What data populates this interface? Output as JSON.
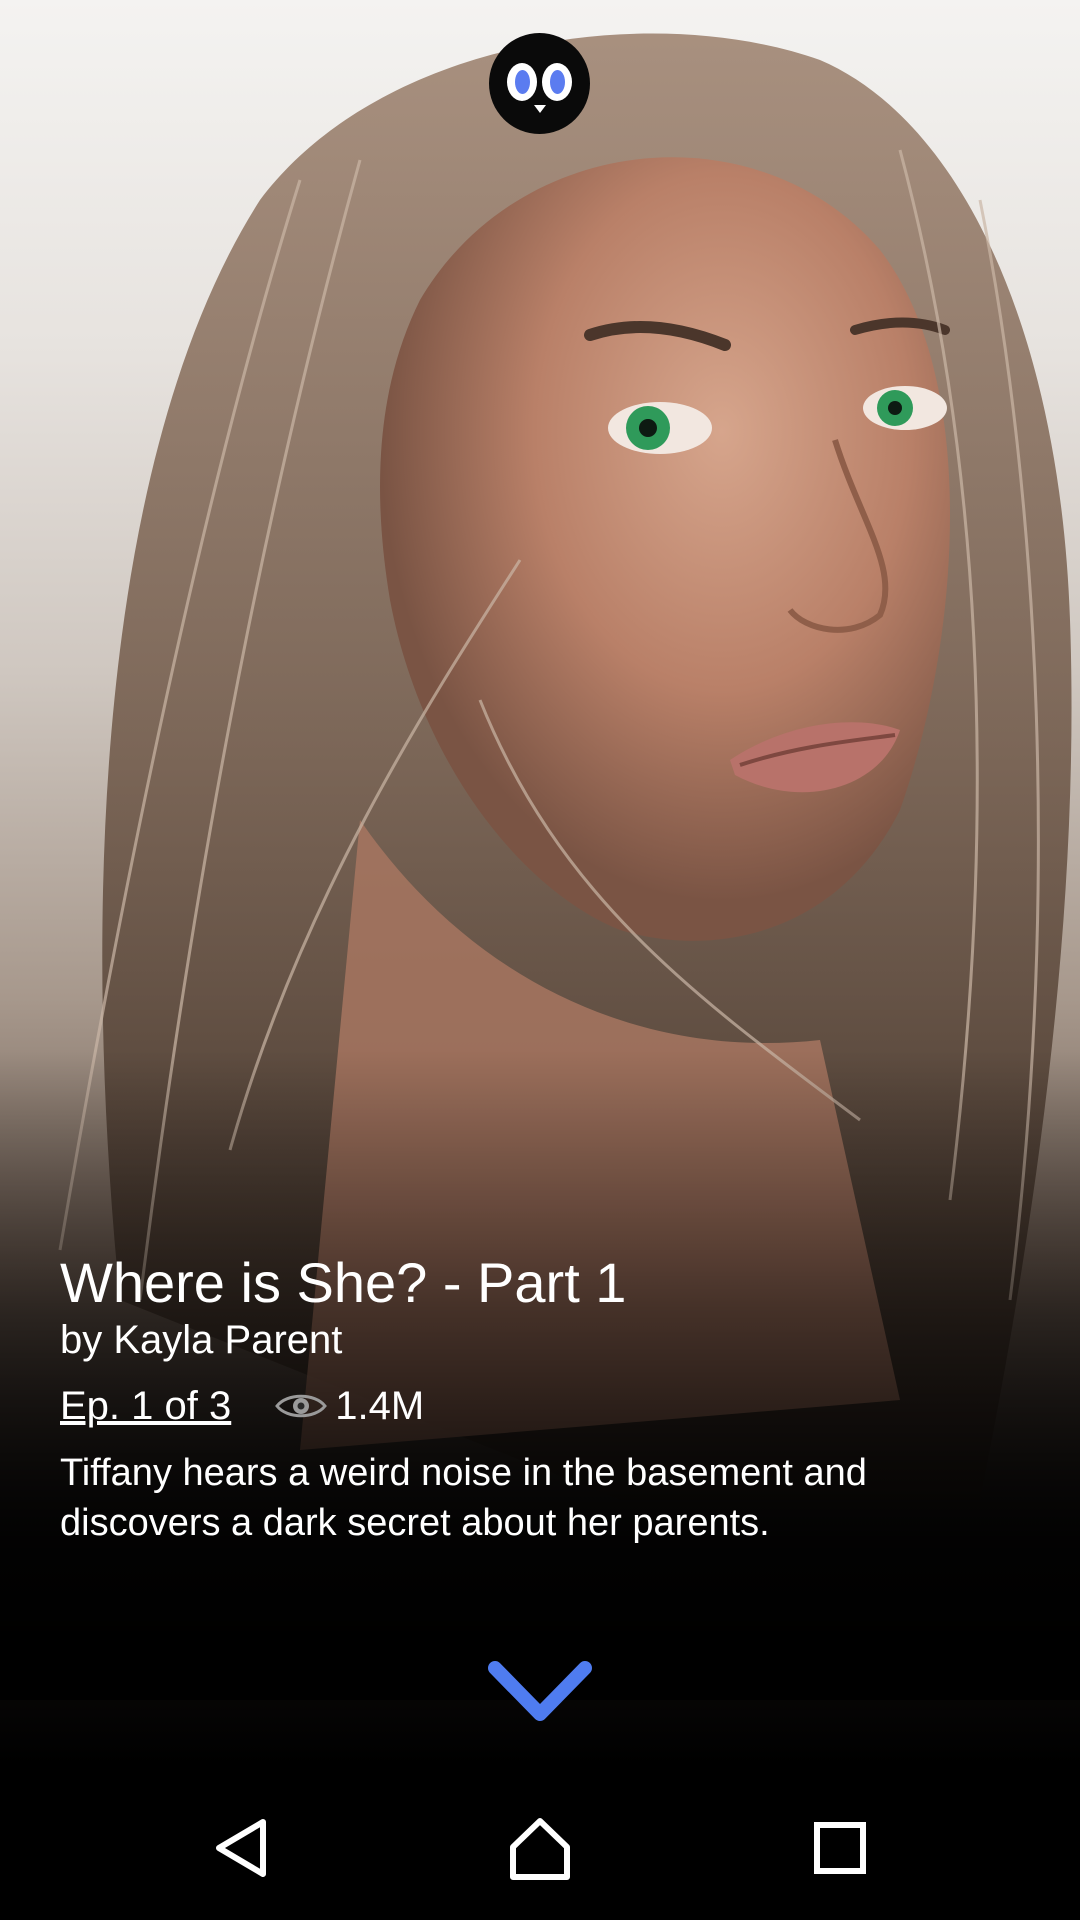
{
  "app": {
    "logo_icon": "owl-logo-icon"
  },
  "story": {
    "title": "Where is She? - Part 1",
    "author": "by Kayla Parent",
    "episode": "Ep. 1 of 3",
    "views": "1.4M",
    "description": "Tiffany hears a weird noise in the basement and discovers a dark secret about her parents."
  },
  "controls": {
    "expand_icon": "chevron-down-icon",
    "accent_color": "#4f7cf0"
  },
  "navbar": {
    "back_icon": "back-triangle-icon",
    "home_icon": "home-icon",
    "recents_icon": "recents-square-icon"
  }
}
